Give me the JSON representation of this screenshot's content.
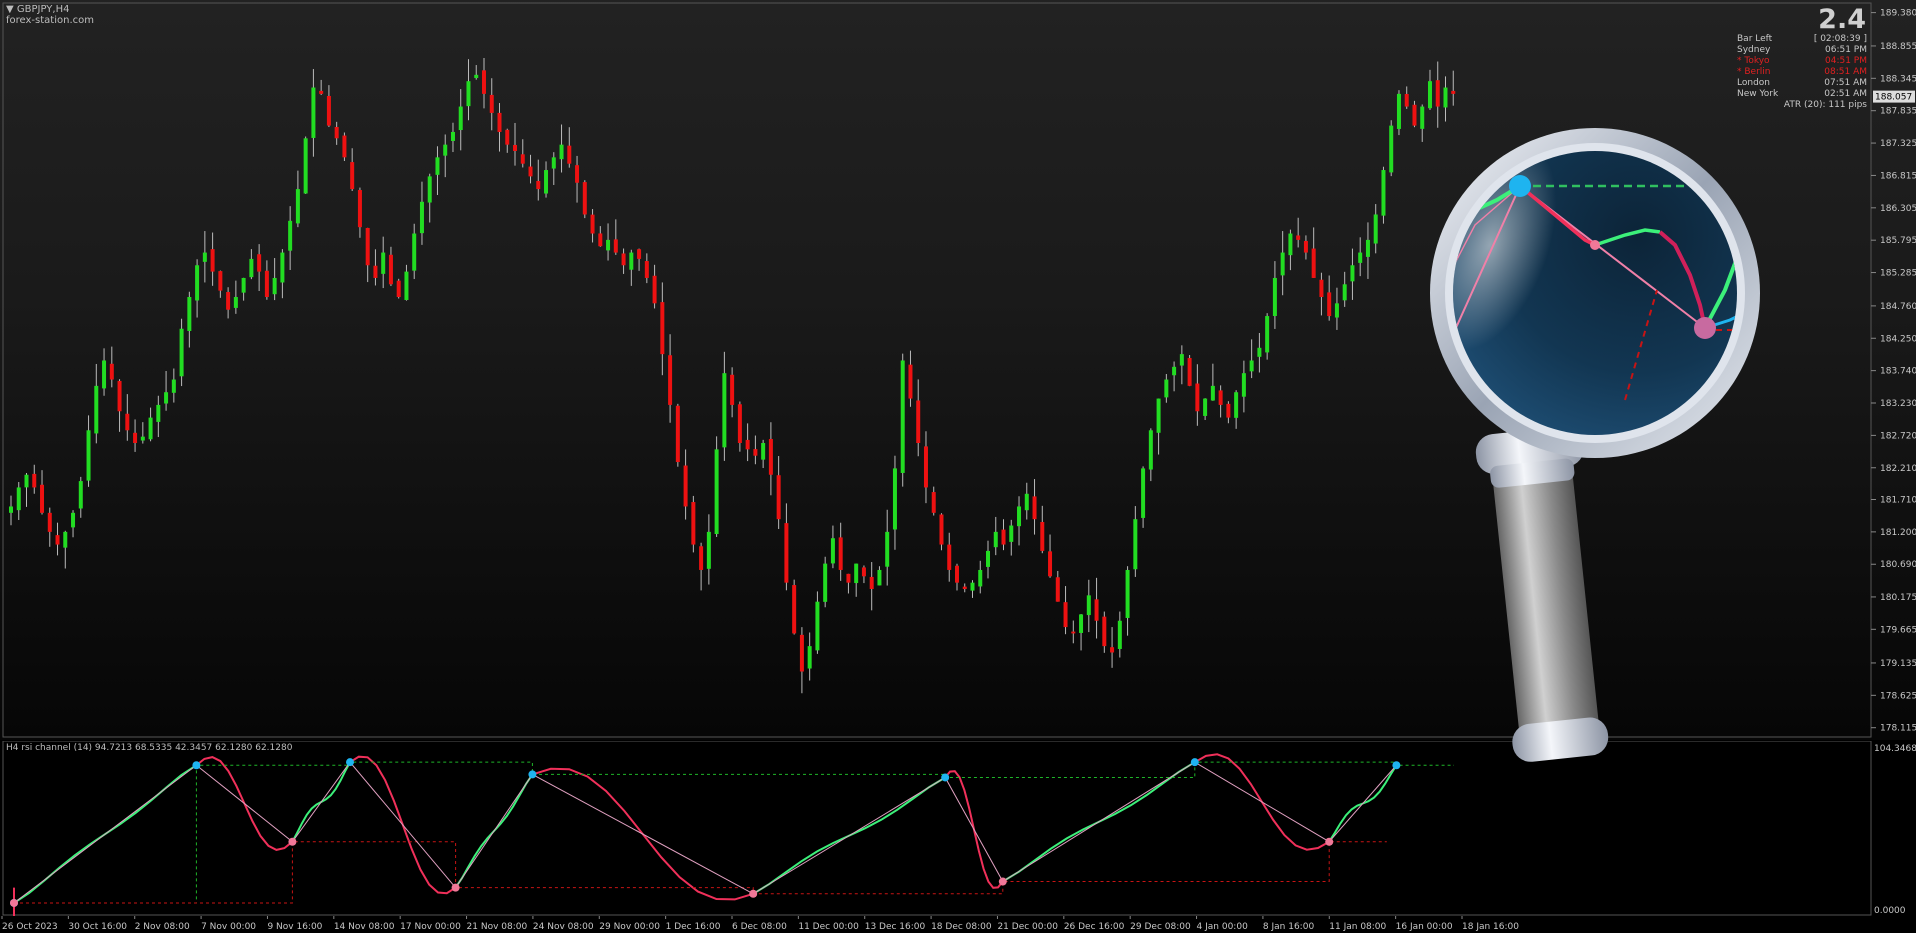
{
  "header": {
    "symbol": "GBPJPY,H4",
    "site": "forex-station.com",
    "spread": "2.4"
  },
  "info_panel": [
    {
      "label": "Bar Left",
      "value": "[ 02:08:39 ]",
      "color": "#c8c8c8"
    },
    {
      "label": "Sydney",
      "value": "06:51 PM",
      "color": "#c8c8c8"
    },
    {
      "label": "* Tokyo",
      "value": "04:51 PM",
      "color": "#e02020"
    },
    {
      "label": "* Berlin",
      "value": "08:51 AM",
      "color": "#e02020"
    },
    {
      "label": "London",
      "value": "07:51 AM",
      "color": "#c8c8c8"
    },
    {
      "label": "New York",
      "value": "02:51 AM",
      "color": "#c8c8c8"
    }
  ],
  "atr_text": "ATR (20): 111 pips",
  "current_price": "188.057",
  "indicator": {
    "label": "H4 rsi channel (14) 94.7213 68.5335 42.3457 62.1280 62.1280",
    "scale_top": "104.3468",
    "scale_bottom": "0.0000"
  },
  "colors": {
    "bull": "#22dd22",
    "bear": "#ee1111",
    "rsi_up": "#3cf07a",
    "rsi_down": "#f0305a",
    "channel_upper": "#1eb428",
    "channel_lower": "#c81414",
    "peak": "#1eb4f0",
    "trough": "#f07898"
  },
  "chart_data": {
    "type": "candlestick",
    "title": "GBPJPY,H4",
    "price_ticks": [
      "189.380",
      "188.855",
      "188.345",
      "187.835",
      "187.325",
      "186.815",
      "186.305",
      "185.795",
      "185.285",
      "184.760",
      "184.250",
      "183.740",
      "183.230",
      "182.720",
      "182.210",
      "181.710",
      "181.200",
      "180.690",
      "180.175",
      "179.665",
      "179.135",
      "178.625",
      "178.115"
    ],
    "x_labels": [
      "26 Oct 2023",
      "30 Oct 16:00",
      "2 Nov 08:00",
      "7 Nov 00:00",
      "9 Nov 16:00",
      "14 Nov 08:00",
      "17 Nov 00:00",
      "21 Nov 08:00",
      "24 Nov 08:00",
      "29 Nov 00:00",
      "1 Dec 16:00",
      "6 Dec 08:00",
      "11 Dec 00:00",
      "13 Dec 16:00",
      "18 Dec 08:00",
      "21 Dec 00:00",
      "26 Dec 16:00",
      "29 Dec 08:00",
      "4 Jan 00:00",
      "8 Jan 16:00",
      "11 Jan 08:00",
      "16 Jan 00:00",
      "18 Jan 16:00"
    ],
    "ylim": [
      178.0,
      189.5
    ],
    "close_path": [
      181.6,
      181.9,
      182.1,
      181.9,
      181.5,
      181.2,
      181.0,
      181.2,
      181.5,
      182.0,
      182.8,
      183.5,
      183.9,
      183.6,
      183.1,
      182.8,
      182.6,
      182.7,
      183.0,
      183.2,
      183.4,
      183.6,
      184.4,
      184.9,
      185.4,
      185.6,
      185.3,
      185.0,
      184.7,
      184.9,
      185.2,
      185.5,
      185.3,
      184.9,
      185.2,
      185.6,
      186.1,
      186.6,
      187.4,
      188.2,
      188.1,
      187.6,
      187.4,
      187.1,
      186.6,
      186.0,
      185.4,
      185.2,
      185.6,
      185.1,
      184.9,
      185.3,
      185.9,
      186.4,
      186.8,
      187.1,
      187.3,
      187.5,
      187.9,
      188.3,
      188.4,
      188.1,
      187.8,
      187.5,
      187.3,
      187.2,
      187.0,
      186.8,
      186.6,
      186.9,
      187.1,
      187.3,
      187.0,
      186.7,
      186.2,
      185.9,
      185.7,
      185.8,
      185.6,
      185.4,
      185.6,
      185.5,
      185.2,
      184.8,
      184.0,
      183.2,
      182.3,
      181.6,
      181.0,
      180.6,
      181.2,
      182.5,
      183.7,
      183.2,
      182.6,
      182.5,
      182.4,
      182.6,
      182.1,
      181.4,
      180.4,
      179.6,
      179.0,
      179.4,
      180.1,
      180.7,
      181.1,
      180.6,
      180.4,
      180.7,
      180.5,
      180.3,
      180.6,
      181.2,
      182.2,
      183.9,
      183.3,
      182.6,
      181.9,
      181.5,
      181.0,
      180.6,
      180.4,
      180.3,
      180.4,
      180.6,
      180.9,
      181.2,
      181.0,
      181.3,
      181.6,
      181.8,
      181.4,
      180.9,
      180.5,
      180.1,
      179.7,
      179.6,
      179.9,
      180.2,
      179.8,
      179.4,
      179.3,
      179.8,
      180.6,
      181.4,
      182.2,
      182.8,
      183.3,
      183.6,
      183.8,
      184.0,
      183.5,
      183.1,
      183.3,
      183.5,
      183.2,
      183.0,
      183.4,
      183.7,
      183.9,
      184.1,
      184.6,
      185.2,
      185.6,
      185.9,
      185.8,
      185.6,
      185.2,
      184.9,
      184.6,
      184.8,
      185.1,
      185.4,
      185.6,
      185.8,
      186.2,
      186.9,
      187.6,
      188.1,
      187.9,
      187.6,
      187.9,
      188.3,
      187.9,
      188.2,
      188.1
    ],
    "rsi_lines": [
      {
        "name": "zigzag_peaks",
        "points": [
          [
            0,
            2
          ],
          [
            19,
            92
          ],
          [
            35,
            94
          ],
          [
            54,
            86
          ],
          [
            97,
            84
          ],
          [
            123,
            94
          ],
          [
            144,
            92
          ]
        ]
      },
      {
        "name": "zigzag_troughs",
        "points": [
          [
            0,
            2
          ],
          [
            29,
            42
          ],
          [
            46,
            12
          ],
          [
            77,
            8
          ],
          [
            103,
            16
          ],
          [
            137,
            42
          ]
        ]
      }
    ]
  }
}
